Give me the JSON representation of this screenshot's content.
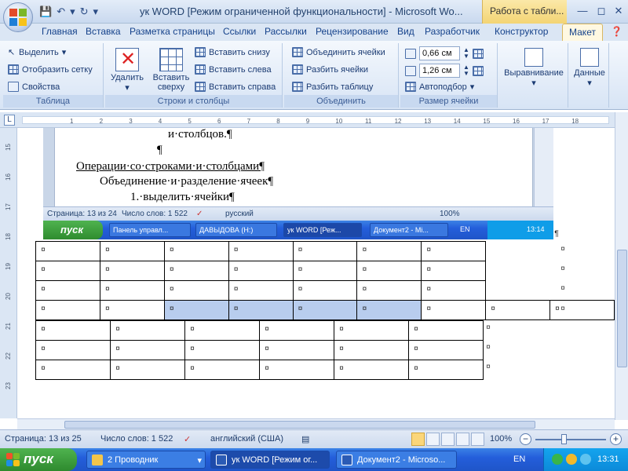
{
  "window": {
    "title": "ук WORD [Режим ограниченной функциональности] - Microsoft Wo...",
    "context_title": "Работа с табли..."
  },
  "ribbon_tabs": [
    {
      "label": "Главная"
    },
    {
      "label": "Вставка"
    },
    {
      "label": "Разметка страницы"
    },
    {
      "label": "Ссылки"
    },
    {
      "label": "Рассылки"
    },
    {
      "label": "Рецензирование"
    },
    {
      "label": "Вид"
    },
    {
      "label": "Разработчик"
    },
    {
      "label": "Конструктор"
    },
    {
      "label": "Макет"
    }
  ],
  "groups": {
    "table": {
      "label": "Таблица",
      "select": "Выделить",
      "show_grid": "Отобразить сетку",
      "properties": "Свойства"
    },
    "rows_cols": {
      "label": "Строки и столбцы",
      "delete": "Удалить",
      "insert_above_1": "Вставить",
      "insert_above_2": "сверху",
      "insert_below": "Вставить снизу",
      "insert_left": "Вставить слева",
      "insert_right": "Вставить справа"
    },
    "merge": {
      "label": "Объединить",
      "merge_cells": "Объединить ячейки",
      "split_cells": "Разбить ячейки",
      "split_table": "Разбить таблицу"
    },
    "cell_size": {
      "label": "Размер ячейки",
      "height": "0,66 см",
      "width": "1,26 см",
      "autofit": "Автоподбор"
    },
    "alignment": {
      "label": "Выравнивание"
    },
    "data": {
      "label": "Данные"
    }
  },
  "ruler": {
    "corner": "L",
    "numbers": [
      "1",
      "2",
      "3",
      "4",
      "5",
      "6",
      "7",
      "8",
      "9",
      "10",
      "11",
      "12",
      "13",
      "14",
      "15",
      "16",
      "17",
      "18"
    ],
    "vnumbers": [
      "15",
      "16",
      "17",
      "18",
      "19",
      "20",
      "21",
      "22",
      "23"
    ]
  },
  "inner": {
    "line1": "и·столбцов.¶",
    "line2": "¶",
    "line3": "Операции·со·строками·и·столбцами¶",
    "line4": "Объединение·и·разделение·ячеек¶",
    "line5": "1.·выделить·ячейки¶",
    "status_page": "Страница: 13 из 24",
    "status_words": "Число слов: 1 522",
    "status_lang": "русский",
    "zoom": "100%",
    "start": "пуск",
    "tasks": [
      "Панель управл...",
      "ДАВЫДОВА (H:)",
      "ук WORD [Реж...",
      "Документ2 - Mi..."
    ],
    "lang": "EN",
    "clock": "13:14"
  },
  "table": {
    "cell_mark": "¤",
    "end_mark": "¤",
    "para_mark": "¶"
  },
  "status": {
    "page": "Страница: 13 из 25",
    "words": "Число слов: 1 522",
    "lang": "английский (США)",
    "zoom": "100%",
    "zoom_minus": "−",
    "zoom_plus": "+"
  },
  "taskbar": {
    "start": "пуск",
    "tasks": [
      "2 Проводник",
      "ук WORD [Режим ог...",
      "Документ2 - Microso..."
    ],
    "lang": "EN",
    "clock": "13:31"
  },
  "colors": {
    "selection": "#b8cdee",
    "taskbar": "#245edb",
    "start": "#3a9a3a"
  }
}
